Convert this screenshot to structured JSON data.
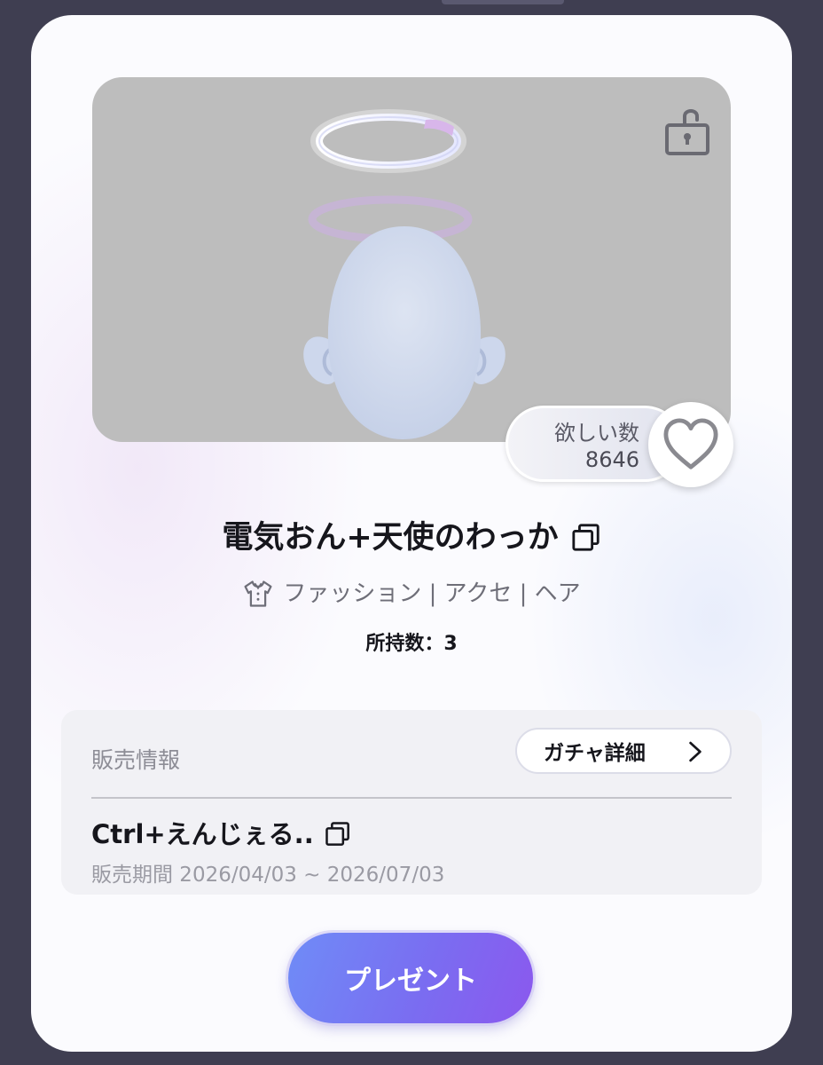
{
  "item": {
    "name": "電気おん+天使のわっか",
    "category_path": "ファッション | アクセ | ヘア",
    "owned_text": "所持数：3"
  },
  "wish": {
    "label": "欲しい数",
    "count": "8646"
  },
  "sales": {
    "section_label": "販売情報",
    "gacha_button_label": "ガチャ詳細",
    "gacha_name": "Ctrl+えんじぇる..",
    "period_text": "販売期間 2026/04/03 ~ 2026/07/03"
  },
  "actions": {
    "present_label": "プレゼント"
  },
  "icons": {
    "lock": "unlocked-padlock-icon",
    "heart": "heart-outline-icon",
    "copy": "copy-icon",
    "category": "shirt-icon",
    "chevron": "chevron-right-icon"
  },
  "colors": {
    "background": "#3f3e51",
    "card": "#fbfbfe",
    "preview_bg": "#bdbdbd",
    "button_gradient_start": "#6f8cf7",
    "button_gradient_end": "#8b58ee"
  }
}
